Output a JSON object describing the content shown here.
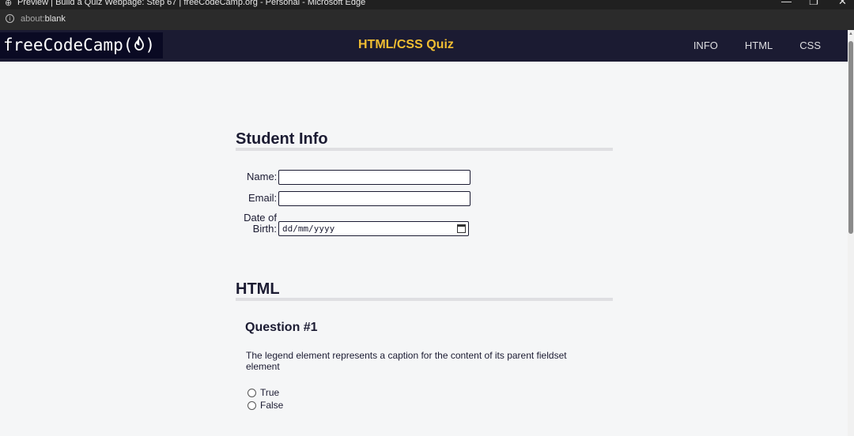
{
  "browser": {
    "window_title": "Preview | Build a Quiz Webpage: Step 67 | freeCodeCamp.org - Personal - Microsoft Edge",
    "address_prefix": "about:",
    "address_rest": "blank",
    "minimize_glyph": "—",
    "restore_glyph": "❐",
    "close_glyph": "✕"
  },
  "nav": {
    "logo_text": "freeCodeCamp(",
    "logo_end": ")",
    "title": "HTML/CSS Quiz",
    "links": [
      "INFO",
      "HTML",
      "CSS"
    ]
  },
  "student_info": {
    "heading": "Student Info",
    "name_label": "Name:",
    "email_label": "Email:",
    "dob_label_line1": "Date of",
    "dob_label_line2": "Birth:",
    "dob_placeholder": "dd/mm/yyyy"
  },
  "html_section": {
    "heading": "HTML",
    "question_heading": "Question #1",
    "question_text": "The legend element represents a caption for the content of its parent fieldset element",
    "options": [
      "True",
      "False"
    ]
  },
  "colors": {
    "nav_bg": "#1b1b32",
    "accent": "#f1be32",
    "page_bg": "#f5f6f7"
  }
}
